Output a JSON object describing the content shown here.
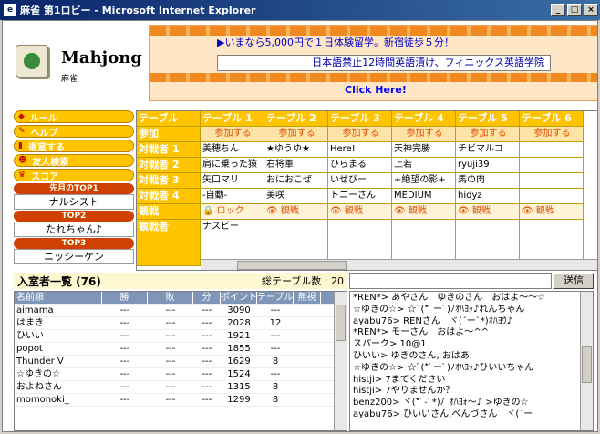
{
  "window": {
    "title": "麻雀 第1ロビー - Microsoft Internet Explorer",
    "min": "_",
    "max": "□",
    "close": "×"
  },
  "logo": {
    "name": "Mahjong",
    "sub": "麻雀"
  },
  "banner": {
    "line1": "▶いまなら5,000円で１日体験留学。新宿徒歩５分！",
    "line2": "日本語禁止12時間英語漬け、フィニックス英語学院",
    "link": "Click Here!"
  },
  "menu": {
    "items": [
      "ルール",
      "ヘルプ",
      "退室する",
      "友人検索",
      "スコア"
    ],
    "top_title": "先月のTOP1",
    "top1": "ナルシスト",
    "top2_title": "TOP2",
    "top2": "たれちゃん♪",
    "top3_title": "TOP3",
    "top3": "ニッシーケン"
  },
  "tables": {
    "headers": [
      "テーブル",
      "テーブル 1",
      "テーブル 2",
      "テーブル 3",
      "テーブル 4",
      "テーブル 5",
      "テーブル 6"
    ],
    "join_label": "参加",
    "join_btn": "参加する",
    "rows": [
      {
        "label": "対戦者 1",
        "cells": [
          "美穂ちん",
          "★ゆうゆ★",
          "Here!",
          "天神完勝",
          "チビマルコ",
          ""
        ]
      },
      {
        "label": "対戦者 2",
        "cells": [
          "肩に乗った猿",
          "右将軍",
          "ひらまる",
          "上若",
          "ryuji39",
          ""
        ]
      },
      {
        "label": "対戦者 3",
        "cells": [
          "矢口マリ",
          "おにおこぜ",
          "いせびー",
          "+絶望の影+",
          "馬の肉",
          ""
        ]
      },
      {
        "label": "対戦者 4",
        "cells": [
          "-自動-",
          "美咲",
          "トニーさん",
          "MEDIUM",
          "hidyz",
          ""
        ]
      }
    ],
    "watch_label": "観戦",
    "lock": "🔒 ロック",
    "watch_btn": "👁 観戦",
    "observer_label": "観戦者",
    "observer1": "ナスビー"
  },
  "room": {
    "title": "入室者一覧 (76)",
    "total": "総テーブル数 : 20",
    "send": "送信"
  },
  "userlist": {
    "headers": [
      "名前順",
      "勝",
      "敗",
      "分",
      "ポイント",
      "テーブル",
      "無視"
    ],
    "rows": [
      [
        "aimama",
        "---",
        "---",
        "---",
        "3090",
        "---",
        ""
      ],
      [
        "はまき",
        "---",
        "---",
        "---",
        "2028",
        "12",
        ""
      ],
      [
        "ひいい",
        "---",
        "---",
        "---",
        "1921",
        "---",
        ""
      ],
      [
        "popot",
        "---",
        "---",
        "---",
        "1855",
        "---",
        ""
      ],
      [
        "Thunder V",
        "---",
        "---",
        "---",
        "1629",
        "8",
        ""
      ],
      [
        "☆ゆきの☆",
        "---",
        "---",
        "---",
        "1524",
        "---",
        ""
      ],
      [
        "およねさん",
        "---",
        "---",
        "---",
        "1315",
        "8",
        ""
      ],
      [
        "momonoki_",
        "---",
        "---",
        "---",
        "1299",
        "8",
        ""
      ]
    ]
  },
  "chat": [
    "*REN*> あやさん　ゆきのさん　おはよ～～☆",
    "☆ゆきの☆> ☆ﾟ(*ﾟーﾟ)ﾉｵﾊﾖｯ♪れんちゃん",
    "ayabu76> RENさん　ヾ(´ー`*)ｵﾊﾖｳ♪",
    "*REN*> モーさん　おはよ～^^",
    "スパーク> 10@1",
    "ひいい> ゆきのさん, おはあ",
    "☆ゆきの☆> ☆ﾟ(*ﾟーﾟ)ﾉｵﾊﾖｯ♪ひいいちゃん",
    "histji> 7まてください",
    "histji> 7やりませんか？",
    "benz200> ヾ(*ﾟ-ﾟ*)ﾉﾞｵﾊﾖｫ～♪ >ゆきの☆",
    "ayabu76> ひいいさん,べんづさん　ヾ(´ー"
  ]
}
